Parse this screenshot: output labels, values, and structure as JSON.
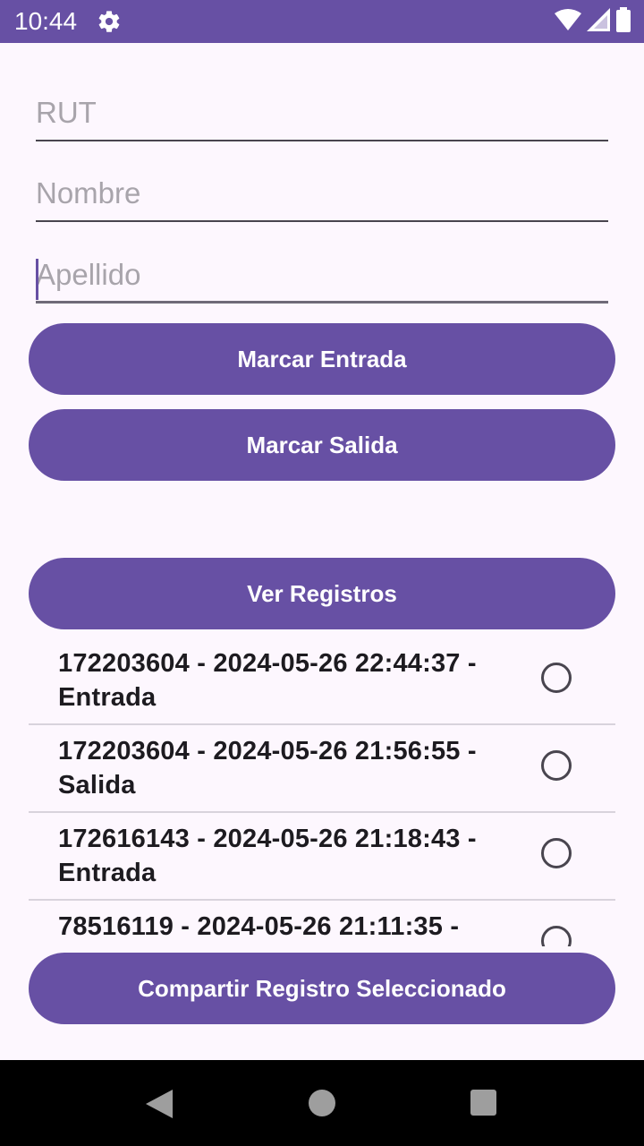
{
  "status_bar": {
    "time": "10:44",
    "icons": [
      "gear-icon",
      "wifi-icon",
      "signal-icon",
      "battery-icon"
    ]
  },
  "form": {
    "rut_placeholder": "RUT",
    "rut_value": "",
    "nombre_placeholder": "Nombre",
    "nombre_value": "",
    "apellido_placeholder": "Apellido",
    "apellido_value": ""
  },
  "buttons": {
    "marcar_entrada": "Marcar Entrada",
    "marcar_salida": "Marcar Salida",
    "ver_registros": "Ver Registros",
    "compartir": "Compartir Registro Seleccionado"
  },
  "records": [
    {
      "text": "172203604 - 2024-05-26 22:44:37 - Entrada",
      "selected": false
    },
    {
      "text": "172203604 - 2024-05-26 21:56:55 - Salida",
      "selected": false
    },
    {
      "text": "172616143 - 2024-05-26 21:18:43 - Entrada",
      "selected": false
    },
    {
      "text": "78516119 - 2024-05-26 21:11:35 -",
      "selected": false
    }
  ],
  "colors": {
    "primary": "#6750a4",
    "background": "#fdf7fe",
    "on_surface": "#1d1b20",
    "nav_bar": "#000000"
  },
  "nav_bar": {
    "icons": [
      "back-icon",
      "home-icon",
      "recents-icon"
    ]
  }
}
